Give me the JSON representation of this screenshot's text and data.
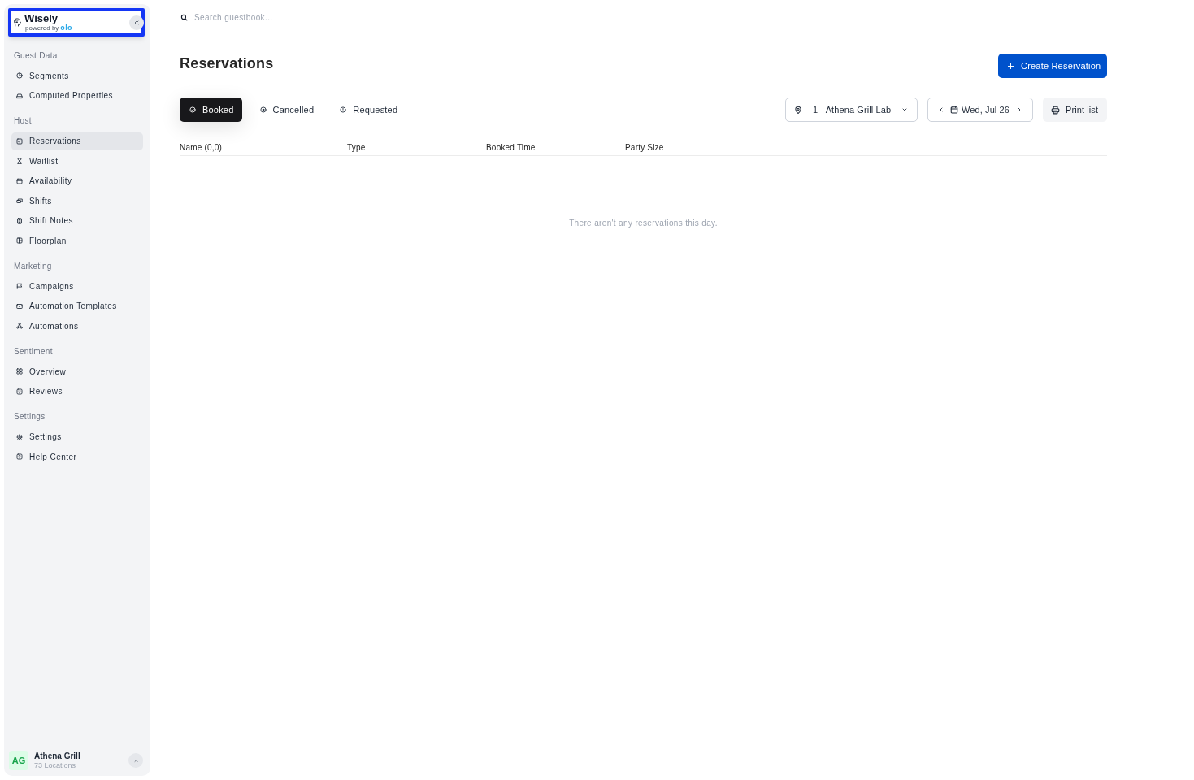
{
  "sidebar": {
    "brand": {
      "name": "Wisely",
      "tagline": "powered by",
      "partner": "olo",
      "focused": true
    },
    "sections": [
      {
        "title": "Guest Data",
        "items": [
          {
            "label": "Segments",
            "selected": false
          },
          {
            "label": "Computed Properties",
            "selected": false
          }
        ]
      },
      {
        "title": "Host",
        "items": [
          {
            "label": "Reservations",
            "selected": true
          },
          {
            "label": "Waitlist",
            "selected": false
          },
          {
            "label": "Availability",
            "selected": false
          },
          {
            "label": "Shifts",
            "selected": false
          },
          {
            "label": "Shift Notes",
            "selected": false
          },
          {
            "label": "Floorplan",
            "selected": false
          }
        ]
      },
      {
        "title": "Marketing",
        "items": [
          {
            "label": "Campaigns",
            "selected": false
          },
          {
            "label": "Automation Templates",
            "selected": false
          },
          {
            "label": "Automations",
            "selected": false
          }
        ]
      },
      {
        "title": "Sentiment",
        "items": [
          {
            "label": "Overview",
            "selected": false
          },
          {
            "label": "Reviews",
            "selected": false
          }
        ]
      },
      {
        "title": "Settings",
        "items": [
          {
            "label": "Settings",
            "selected": false
          },
          {
            "label": "Help Center",
            "selected": false
          }
        ]
      }
    ],
    "account": {
      "initials": "AG",
      "name": "Athena Grill",
      "subtitle": "73 Locations"
    }
  },
  "search": {
    "placeholder": "Search guestbook..."
  },
  "page": {
    "title": "Reservations",
    "primary_button": "Create Reservation"
  },
  "tabs": [
    {
      "label": "Booked",
      "selected": true
    },
    {
      "label": "Cancelled",
      "selected": false
    },
    {
      "label": "Requested",
      "selected": false
    }
  ],
  "filters": {
    "location": "1 - Athena Grill Lab",
    "date": "Wed, Jul 26",
    "print_button": "Print list"
  },
  "table": {
    "columns": [
      "Name (0,0)",
      "Type",
      "Booked Time",
      "Party Size"
    ],
    "empty_message": "There aren't any reservations this day."
  }
}
